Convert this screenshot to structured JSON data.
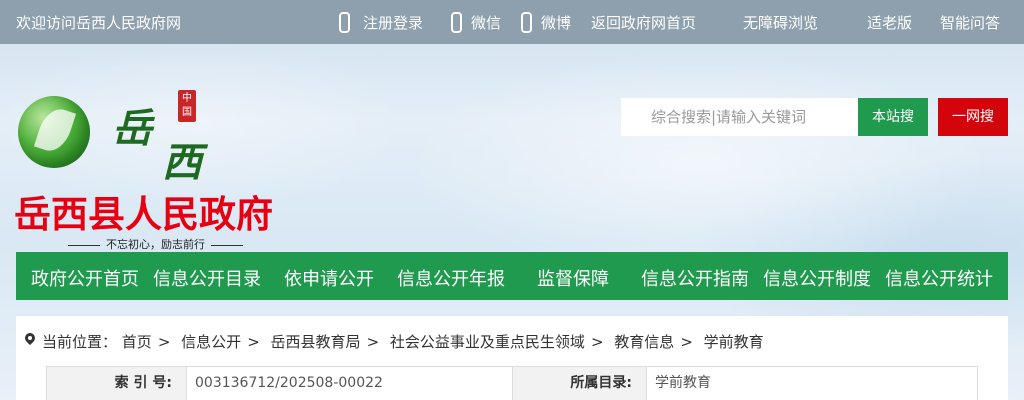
{
  "topbar": {
    "welcome": "欢迎访问岳西人民政府网",
    "links": [
      "注册登录",
      "微信",
      "微博",
      "返回政府网首页",
      "无障碍浏览",
      "适老版",
      "智能问答"
    ]
  },
  "logo": {
    "callig": "岳西",
    "seal": "中国",
    "site_title": "岳西县人民政府",
    "slogan": "不忘初心，励志前行"
  },
  "search": {
    "placeholder": "综合搜索|请输入关键词",
    "value": "",
    "site_button": "本站搜",
    "all_button": "一网搜"
  },
  "nav": {
    "items": [
      "政府公开首页",
      "信息公开目录",
      "依申请公开",
      "信息公开年报",
      "监督保障",
      "信息公开指南",
      "信息公开制度",
      "信息公开统计"
    ]
  },
  "breadcrumb": {
    "label": "当前位置：",
    "items": [
      "首页",
      "信息公开",
      "岳西县教育局",
      "社会公益事业及重点民生领域",
      "教育信息",
      "学前教育"
    ],
    "separator": ">"
  },
  "meta": {
    "index_label": "索 引 号:",
    "index_value": "003136712/202508-00022",
    "catalog_label": "所属目录:",
    "catalog_value": "学前教育"
  },
  "colors": {
    "topbar": "#8e9fae",
    "nav_green": "#1f9a4f",
    "title_red": "#e60012",
    "btn_red": "#d4040d"
  }
}
